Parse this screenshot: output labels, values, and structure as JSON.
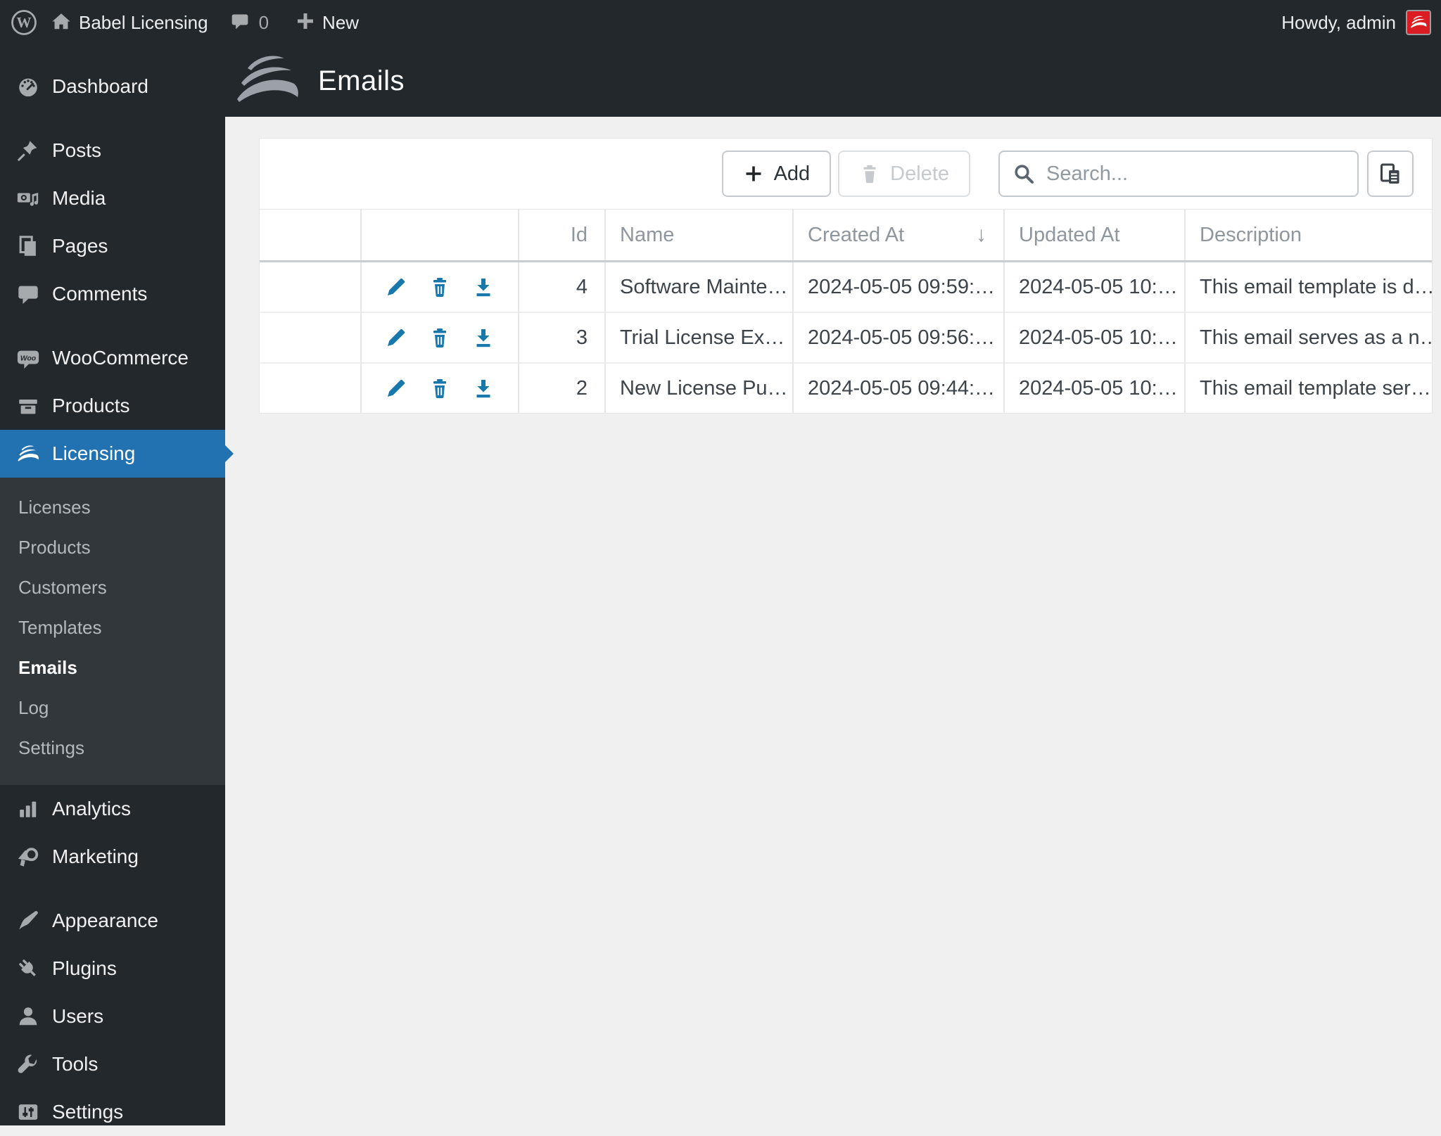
{
  "admin_bar": {
    "site_name": "Babel Licensing",
    "comments_count": "0",
    "new_label": "New",
    "howdy": "Howdy, admin",
    "icons": [
      "wordpress-logo-icon",
      "home-icon",
      "comments-bubble-icon",
      "plus-icon",
      "avatar-babel-icon"
    ]
  },
  "page_header": {
    "title": "Emails",
    "logo": "babel-waves-logo"
  },
  "sidebar": {
    "items": [
      {
        "label": "Dashboard",
        "icon": "dashboard-icon"
      },
      {
        "label": "Posts",
        "icon": "pin-icon"
      },
      {
        "label": "Media",
        "icon": "media-icon"
      },
      {
        "label": "Pages",
        "icon": "pages-icon"
      },
      {
        "label": "Comments",
        "icon": "comment-icon"
      },
      {
        "label": "WooCommerce",
        "icon": "woocommerce-icon"
      },
      {
        "label": "Products",
        "icon": "box-icon"
      },
      {
        "label": "Licensing",
        "icon": "babel-waves-icon",
        "active": true
      },
      {
        "label": "Analytics",
        "icon": "bar-chart-icon"
      },
      {
        "label": "Marketing",
        "icon": "megaphone-icon"
      },
      {
        "label": "Appearance",
        "icon": "brush-icon"
      },
      {
        "label": "Plugins",
        "icon": "plug-icon"
      },
      {
        "label": "Users",
        "icon": "user-icon"
      },
      {
        "label": "Tools",
        "icon": "wrench-icon"
      },
      {
        "label": "Settings",
        "icon": "sliders-icon"
      }
    ],
    "licensing_submenu": [
      {
        "label": "Licenses"
      },
      {
        "label": "Products"
      },
      {
        "label": "Customers"
      },
      {
        "label": "Templates"
      },
      {
        "label": "Emails",
        "current": true
      },
      {
        "label": "Log"
      },
      {
        "label": "Settings"
      }
    ]
  },
  "toolbar": {
    "add_label": "Add",
    "delete_label": "Delete",
    "search_placeholder": "Search...",
    "icons": [
      "plus-icon",
      "trash-icon",
      "search-icon",
      "columns-icon"
    ]
  },
  "table": {
    "columns": [
      {
        "label": ""
      },
      {
        "label": ""
      },
      {
        "label": "Id"
      },
      {
        "label": "Name"
      },
      {
        "label": "Created At",
        "sorted": "desc"
      },
      {
        "label": "Updated At"
      },
      {
        "label": "Description"
      }
    ],
    "sort_arrow": "↓",
    "row_actions": [
      "edit-icon",
      "delete-icon",
      "download-icon"
    ],
    "rows": [
      {
        "id": "4",
        "name": "Software Mainte…",
        "created_at": "2024-05-05 09:59:…",
        "updated_at": "2024-05-05 10:…",
        "description": "This email template is d…"
      },
      {
        "id": "3",
        "name": "Trial License Ex…",
        "created_at": "2024-05-05 09:56:…",
        "updated_at": "2024-05-05 10:…",
        "description": "This email serves as a n…"
      },
      {
        "id": "2",
        "name": "New License Pu…",
        "created_at": "2024-05-05 09:44:…",
        "updated_at": "2024-05-05 10:…",
        "description": "This email template ser…"
      }
    ]
  },
  "colors": {
    "accent_blue": "#2271b1",
    "action_blue": "#1878ad",
    "sidebar_bg": "#23282d",
    "submenu_bg": "#32373c",
    "content_bg": "#f0f0f1",
    "avatar_red": "#dc1c23"
  }
}
